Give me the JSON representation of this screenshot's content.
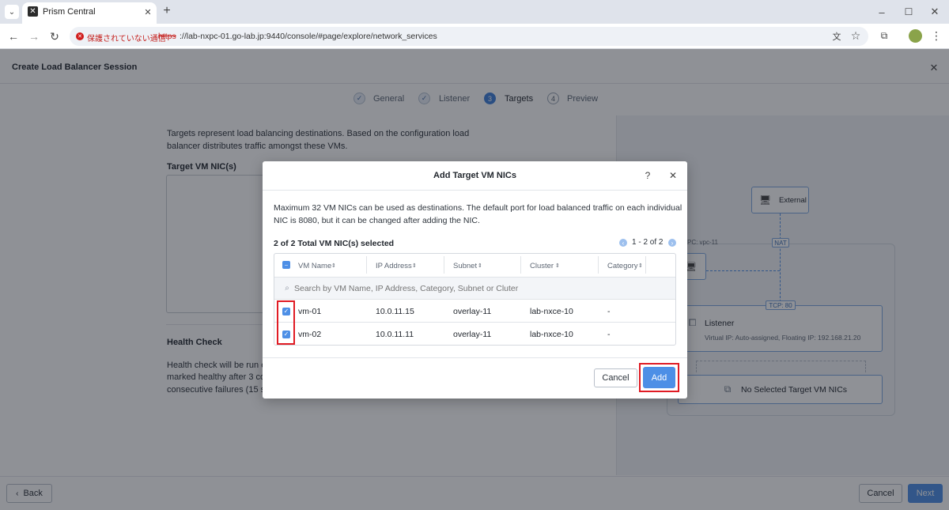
{
  "browser": {
    "tab_title": "Prism Central",
    "security_label": "保護されていない通信",
    "url_scheme": "https",
    "url_rest": "://lab-nxpc-01.go-lab.jp:9440/console/#page/explore/network_services"
  },
  "page": {
    "title": "Create Load Balancer Session",
    "steps": [
      {
        "num": "✓",
        "label": "General"
      },
      {
        "num": "✓",
        "label": "Listener"
      },
      {
        "num": "3",
        "label": "Targets"
      },
      {
        "num": "4",
        "label": "Preview"
      }
    ],
    "intro_line1": "Targets represent load balancing destinations. Based on the configuration load",
    "intro_line2": "balancer distributes traffic amongst these VMs.",
    "target_label": "Target VM NIC(s)",
    "health_title": "Health Check",
    "health_line1": "Health check will be run ev",
    "health_line2": "marked healthy after 3 cons",
    "health_line3": "consecutive failures (15 sec",
    "back_label": "Back",
    "cancel_label": "Cancel",
    "next_label": "Next"
  },
  "diagram": {
    "external": "External",
    "nat": "NAT",
    "vpc": "PC: vpc-11",
    "tcp": "TCP: 80",
    "listener": "Listener",
    "listener_sub": "Virtual IP: Auto-assigned,  Floating IP: 192.168.21.20",
    "no_targets": "No Selected Target VM NICs"
  },
  "modal": {
    "title": "Add Target VM NICs",
    "help": "?",
    "close": "✕",
    "desc_line1": "Maximum 32 VM NICs can be used as destinations. The default port for load balanced traffic on each individual",
    "desc_line2": "NIC is 8080, but it can be changed after adding the NIC.",
    "selected": "2 of 2 Total VM NIC(s) selected",
    "pagination": "1 - 2 of 2",
    "columns": [
      "VM Name",
      "IP Address",
      "Subnet",
      "Cluster",
      "Category"
    ],
    "search_placeholder": "Search by VM Name, IP Address, Category, Subnet or Cluter",
    "rows": [
      {
        "name": "vm-01",
        "ip": "10.0.11.15",
        "subnet": "overlay-11",
        "cluster": "lab-nxce-10",
        "category": "-"
      },
      {
        "name": "vm-02",
        "ip": "10.0.11.11",
        "subnet": "overlay-11",
        "cluster": "lab-nxce-10",
        "category": "-"
      }
    ],
    "cancel_label": "Cancel",
    "add_label": "Add"
  },
  "colors": {
    "accent": "#4d8fe6",
    "highlight": "#e01b24"
  }
}
